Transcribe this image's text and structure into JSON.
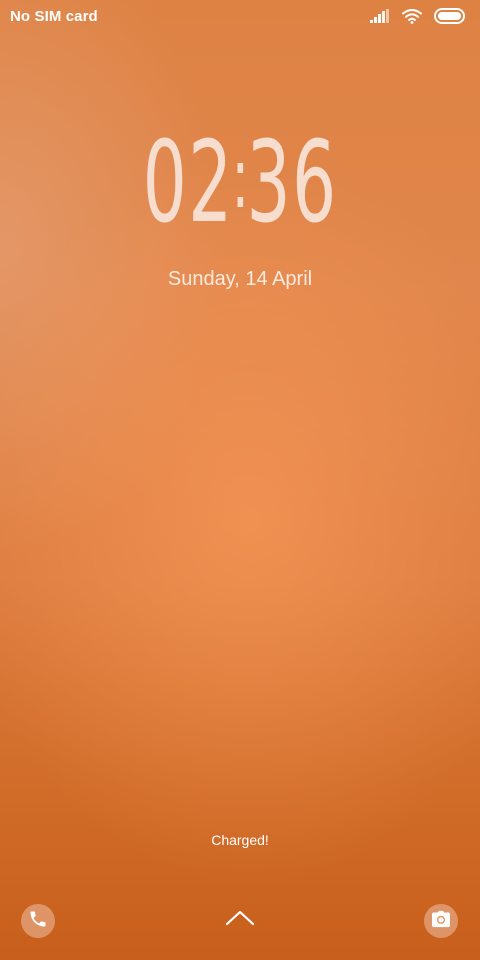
{
  "status_bar": {
    "carrier": "No SIM card",
    "icons": [
      "signal-icon",
      "wifi-icon",
      "battery-icon"
    ]
  },
  "lock_screen": {
    "clock": {
      "hours": "02",
      "minutes": "36"
    },
    "date": "Sunday, 14 April",
    "charge_status": "Charged!",
    "shortcuts": {
      "left": "phone-icon",
      "center": "chevron-up-icon",
      "right": "camera-icon"
    }
  },
  "colors": {
    "wallpaper_top": "#de8244",
    "wallpaper_bottom": "#c85f1c",
    "clock_text": "#f6ddce"
  }
}
